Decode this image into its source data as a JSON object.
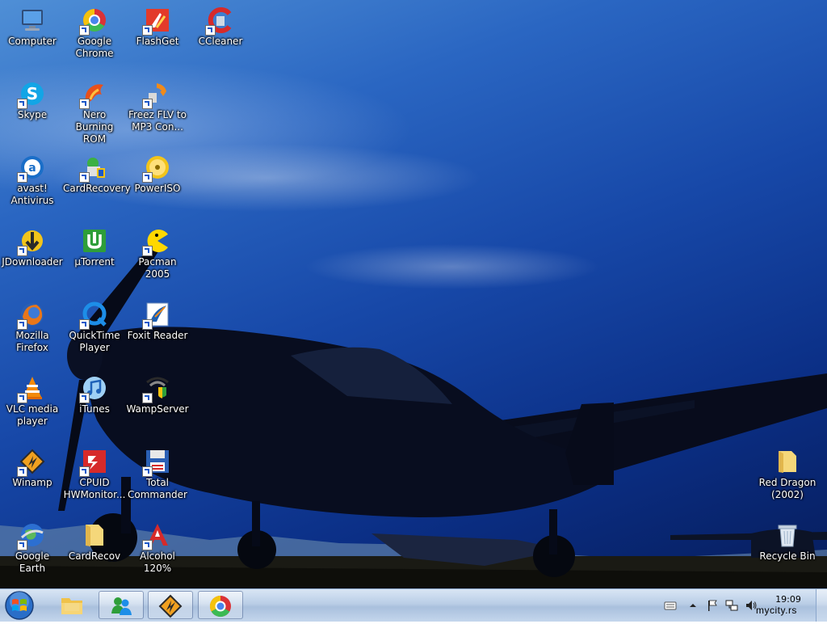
{
  "desktop": {
    "icons": [
      {
        "id": "computer",
        "label": "Computer",
        "icon": "computer-icon"
      },
      {
        "id": "google-chrome",
        "label": "Google\nChrome",
        "icon": "chrome-icon"
      },
      {
        "id": "flashget",
        "label": "FlashGet",
        "icon": "flashget-icon"
      },
      {
        "id": "ccleaner",
        "label": "CCleaner",
        "icon": "ccleaner-icon"
      },
      {
        "id": "skype",
        "label": "Skype",
        "icon": "skype-icon"
      },
      {
        "id": "nero",
        "label": "Nero Burning\nROM",
        "icon": "nero-icon"
      },
      {
        "id": "freez-flv",
        "label": "Freez FLV to\nMP3 Con...",
        "icon": "freez-flv-icon"
      },
      {
        "id": "avast",
        "label": "avast!\nAntivirus",
        "icon": "avast-icon"
      },
      {
        "id": "cardrecovery",
        "label": "CardRecovery",
        "icon": "cardrecovery-icon"
      },
      {
        "id": "poweriso",
        "label": "PowerISO",
        "icon": "poweriso-icon"
      },
      {
        "id": "jdownloader",
        "label": "JDownloader",
        "icon": "jdownloader-icon"
      },
      {
        "id": "utorrent",
        "label": "µTorrent",
        "icon": "utorrent-icon"
      },
      {
        "id": "pacman",
        "label": "Pacman 2005",
        "icon": "pacman-icon"
      },
      {
        "id": "firefox",
        "label": "Mozilla\nFirefox",
        "icon": "firefox-icon"
      },
      {
        "id": "quicktime",
        "label": "QuickTime\nPlayer",
        "icon": "quicktime-icon"
      },
      {
        "id": "foxit",
        "label": "Foxit Reader",
        "icon": "foxit-icon"
      },
      {
        "id": "vlc",
        "label": "VLC media\nplayer",
        "icon": "vlc-icon"
      },
      {
        "id": "itunes",
        "label": "iTunes",
        "icon": "itunes-icon"
      },
      {
        "id": "wampserver",
        "label": "WampServer",
        "icon": "wampserver-icon"
      },
      {
        "id": "winamp",
        "label": "Winamp",
        "icon": "winamp-icon"
      },
      {
        "id": "cpuid",
        "label": "CPUID\nHWMonitor...",
        "icon": "cpuid-icon"
      },
      {
        "id": "total-commander",
        "label": "Total\nCommander",
        "icon": "total-commander-icon"
      },
      {
        "id": "google-earth",
        "label": "Google Earth",
        "icon": "google-earth-icon"
      },
      {
        "id": "cardrecov-folder",
        "label": "CardRecov",
        "icon": "folder-icon"
      },
      {
        "id": "alcohol",
        "label": "Alcohol 120%",
        "icon": "alcohol-icon"
      },
      {
        "id": "red-dragon",
        "label": "Red Dragon\n(2002)",
        "icon": "folder-icon"
      },
      {
        "id": "recycle-bin",
        "label": "Recycle Bin",
        "icon": "recycle-bin-icon"
      }
    ]
  },
  "taskbar": {
    "start_icon": "windows-logo-icon",
    "pinned": [
      {
        "id": "explorer",
        "icon": "explorer-folder-icon"
      },
      {
        "id": "messenger",
        "icon": "messenger-icon"
      },
      {
        "id": "winamp",
        "icon": "winamp-icon"
      },
      {
        "id": "chrome",
        "icon": "chrome-icon"
      }
    ],
    "tray": {
      "icons": [
        "keyboard-icon",
        "chevron-up-icon",
        "flag-icon",
        "network-icon",
        "volume-icon"
      ],
      "time": "19:09"
    }
  },
  "watermark": "mycity.rs"
}
